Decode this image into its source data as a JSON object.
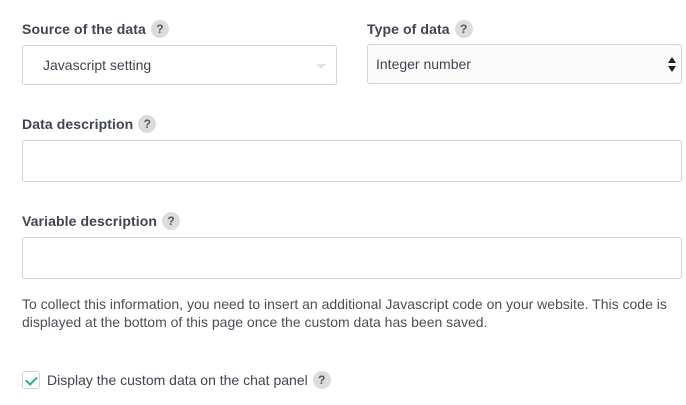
{
  "source_field": {
    "label": "Source of the data",
    "help": "?",
    "selected_value": "Javascript setting"
  },
  "type_field": {
    "label": "Type of data",
    "help": "?",
    "selected_value": "Integer number"
  },
  "data_description": {
    "label": "Data description",
    "help": "?",
    "value": "",
    "placeholder": ""
  },
  "variable_description": {
    "label": "Variable description",
    "help": "?",
    "value": "",
    "placeholder": ""
  },
  "info_text": "To collect this information, you need to insert an additional Javascript code on your website. This code is displayed at the bottom of this page once the custom data has been saved.",
  "display_option": {
    "label": "Display the custom data on the chat panel",
    "help": "?",
    "checked": true
  },
  "colors": {
    "check_accent": "#2fb37a",
    "help_badge": "#dcdcdc",
    "border": "#d0d3d7"
  },
  "icons": {
    "help": "question-mark-badge",
    "dropdown_caret": "caret-down",
    "native_select": "up-down-arrows",
    "checkbox": "check-mark"
  }
}
